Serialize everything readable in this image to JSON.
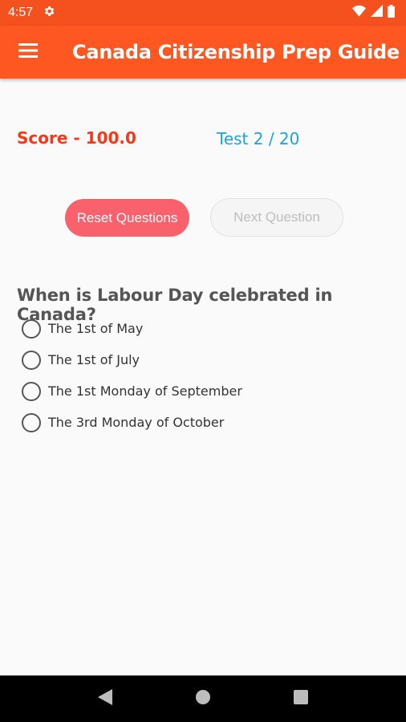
{
  "status_bar": {
    "time": "4:57",
    "icons": [
      "settings-icon",
      "wifi-icon",
      "signal-icon",
      "battery-icon"
    ]
  },
  "app_bar": {
    "title": "Canada Citizenship Prep Guide",
    "menu_icon": "hamburger-menu-icon",
    "color": "#ff5722"
  },
  "quiz": {
    "score_text": "Score - 100.0",
    "test_text": "Test 2 / 20",
    "reset_label": "Reset Questions",
    "next_label": "Next Question",
    "question": "When is Labour Day celebrated in Canada?",
    "options": [
      "The 1st of May",
      "The 1st of July",
      "The 1st Monday of September",
      "The 3rd Monday of October"
    ]
  },
  "nav_bar": {
    "icons": [
      "back-icon",
      "home-icon",
      "recents-icon"
    ]
  }
}
